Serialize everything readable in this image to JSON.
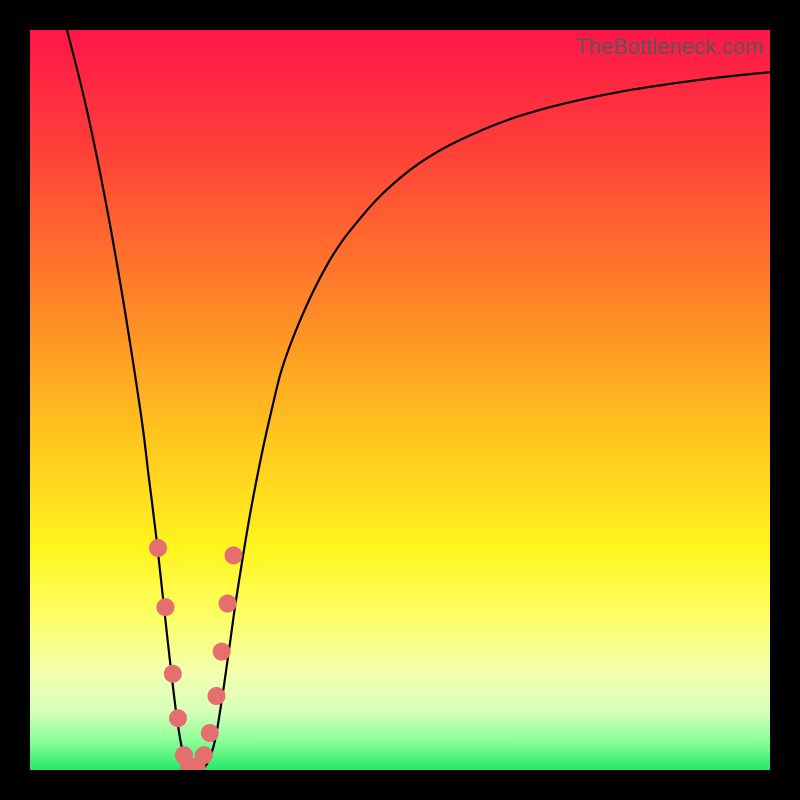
{
  "attribution": "TheBottleneck.com",
  "gradient_stops": [
    {
      "offset": 0.0,
      "color": "#ff1649"
    },
    {
      "offset": 0.15,
      "color": "#ff3c3a"
    },
    {
      "offset": 0.35,
      "color": "#ff7f28"
    },
    {
      "offset": 0.55,
      "color": "#ffc51e"
    },
    {
      "offset": 0.7,
      "color": "#fff51e"
    },
    {
      "offset": 0.8,
      "color": "#fdff6a"
    },
    {
      "offset": 0.87,
      "color": "#f2ffb0"
    },
    {
      "offset": 0.92,
      "color": "#d8ffb8"
    },
    {
      "offset": 0.96,
      "color": "#8cff9a"
    },
    {
      "offset": 1.0,
      "color": "#26e86a"
    }
  ],
  "chart_data": {
    "type": "line",
    "title": "",
    "xlabel": "",
    "ylabel": "",
    "xlim": [
      0,
      100
    ],
    "ylim": [
      0,
      100
    ],
    "series": [
      {
        "name": "bottleneck-curve",
        "x": [
          5,
          7.5,
          10,
          12.5,
          15,
          16,
          17,
          18,
          19,
          20,
          21,
          22,
          23,
          24,
          25,
          26,
          27,
          28,
          30,
          32.5,
          35,
          40,
          45,
          50,
          55,
          60,
          65,
          70,
          75,
          80,
          85,
          90,
          95,
          100
        ],
        "y": [
          100,
          90,
          78,
          64,
          48,
          40,
          32,
          23,
          14,
          6,
          1,
          0,
          0,
          1,
          4,
          10,
          17,
          24,
          36,
          48,
          57,
          68,
          75,
          80,
          83.5,
          86,
          88,
          89.5,
          90.7,
          91.7,
          92.5,
          93.2,
          93.8,
          94.3
        ]
      }
    ],
    "markers": {
      "name": "highlighted-points",
      "color": "#e56f6f",
      "radius": 9,
      "x": [
        17.3,
        18.3,
        19.3,
        20.0,
        20.8,
        21.5,
        22.5,
        23.5,
        24.3,
        25.2,
        25.9,
        26.7,
        27.5
      ],
      "y": [
        30,
        22,
        13,
        7,
        2,
        0.5,
        0.5,
        2,
        5,
        10,
        16,
        22.5,
        29
      ]
    }
  }
}
